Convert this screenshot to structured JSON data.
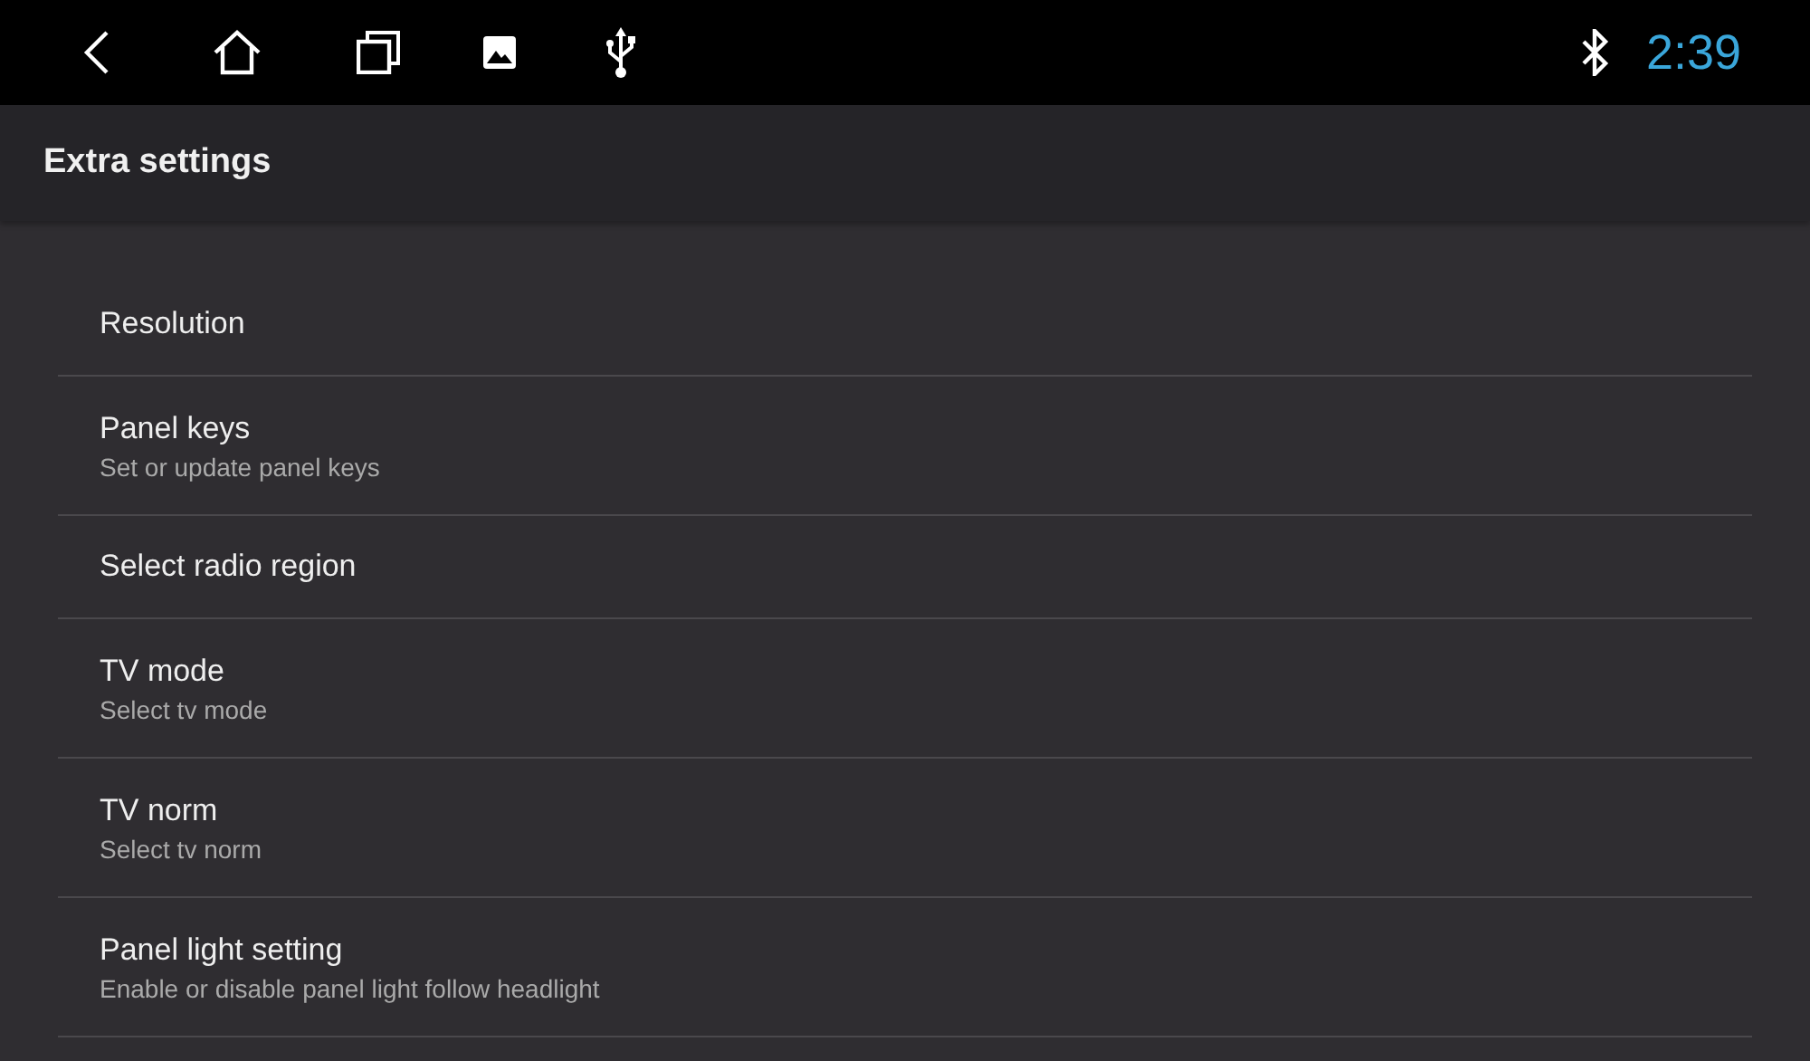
{
  "status_bar": {
    "time": "2:39"
  },
  "toolbar": {
    "title": "Extra settings"
  },
  "settings": [
    {
      "title": "Resolution"
    },
    {
      "title": "Panel keys",
      "summary": "Set or update panel keys"
    },
    {
      "title": "Select radio region"
    },
    {
      "title": "TV mode",
      "summary": "Select tv mode"
    },
    {
      "title": "TV norm",
      "summary": "Select tv norm"
    },
    {
      "title": "Panel light setting",
      "summary": "Enable or disable panel light follow headlight"
    }
  ]
}
